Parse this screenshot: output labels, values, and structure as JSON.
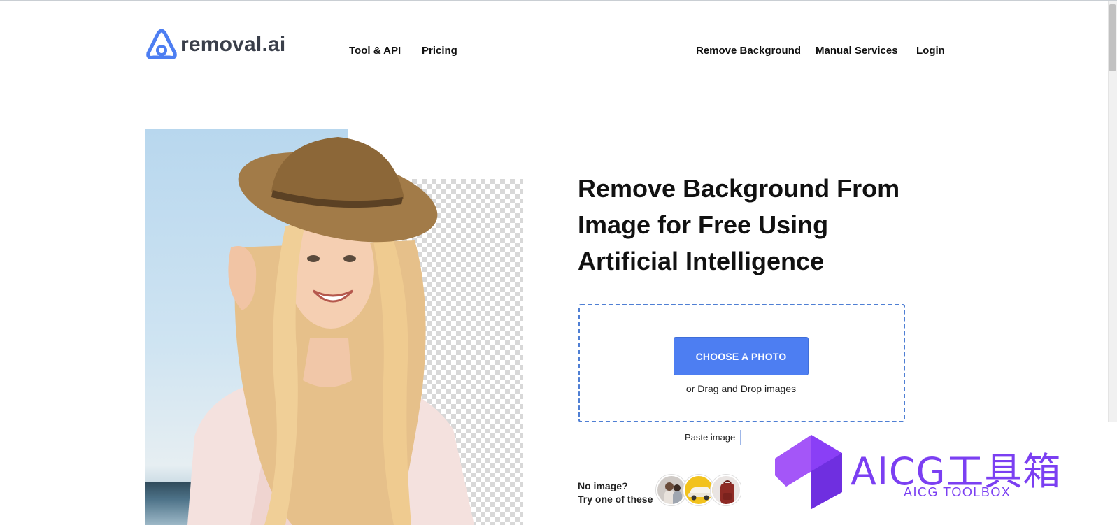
{
  "brand": {
    "name": "removal.ai"
  },
  "nav": {
    "left": [
      "Tool & API",
      "Pricing"
    ],
    "right": [
      "Remove Background",
      "Manual Services",
      "Login"
    ]
  },
  "hero": {
    "headline": "Remove Background From Image for Free Using Artificial Intelligence"
  },
  "upload": {
    "button_label": "CHOOSE A PHOTO",
    "drag_text": "or Drag and Drop images",
    "paste_label": "Paste image"
  },
  "samples": {
    "line1": "No image?",
    "line2": "Try one of these",
    "items": [
      "couple-sample-icon",
      "car-sample-icon",
      "backpack-sample-icon"
    ]
  },
  "watermark": {
    "title": "AICG工具箱",
    "subtitle": "AICG TOOLBOX"
  },
  "colors": {
    "accent": "#4d7ef2",
    "dashed_border": "#4f7fd4",
    "watermark": "#7b3ff2"
  }
}
